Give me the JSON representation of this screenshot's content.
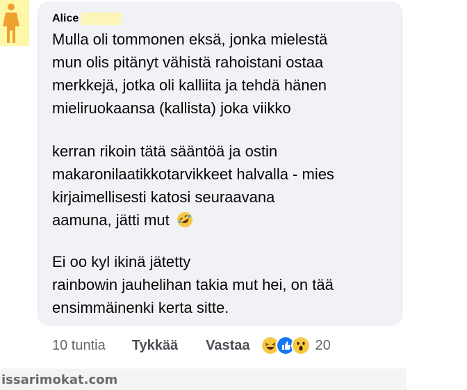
{
  "comment": {
    "author": "Alice",
    "paragraphs": [
      [
        "Mulla oli tommonen eksä, jonka mielestä",
        "mun olis pitänyt vähistä rahoistani ostaa",
        "merkkejä, jotka oli kalliita ja tehdä hänen",
        "mieliruokaansa (kallista) joka viikko"
      ],
      [
        "kerran rikoin tätä sääntöä ja ostin",
        "makaronilaatikkotarvikkeet halvalla - mies",
        "kirjaimellisesti katosi seuraavana",
        "aamuna, jätti mut"
      ],
      [
        "Ei oo kyl ikinä jätetty",
        "rainbowin jauhelihan takia mut hei, on tää",
        "ensimmäinenki kerta sitte."
      ]
    ],
    "inline_emoji": "rolling-on-floor-laughing"
  },
  "actions": {
    "time": "10 tuntia",
    "like": "Tykkää",
    "reply": "Vastaa",
    "reaction_icons": [
      "laughing-reaction",
      "like-reaction",
      "wow-reaction"
    ],
    "reaction_count": "20"
  },
  "footer": {
    "watermark": "issarimokat.com"
  },
  "colors": {
    "bubble": "#f0f2f5",
    "avatar_bg": "#fdf7a8",
    "avatar_figure": "#f0a030",
    "like_blue": "#1877f2",
    "emoji_yellow": "#f7c843"
  }
}
